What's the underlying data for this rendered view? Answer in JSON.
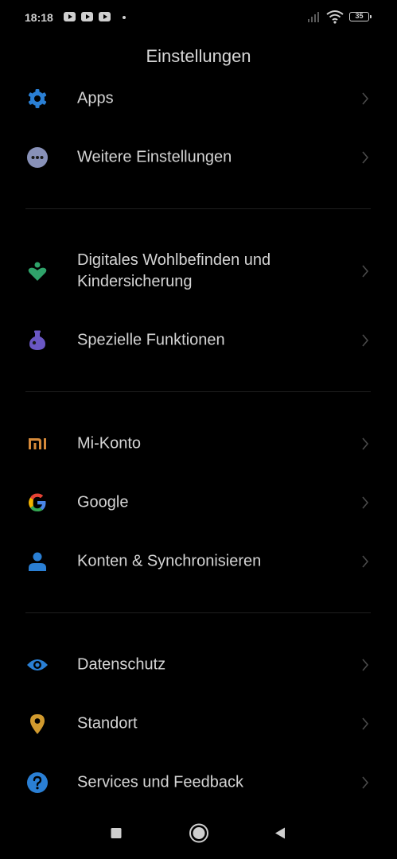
{
  "status_bar": {
    "time": "18:18",
    "notification_icons": [
      "youtube-icon",
      "youtube-icon",
      "youtube-icon"
    ],
    "battery_level": "35"
  },
  "header": {
    "title": "Einstellungen"
  },
  "settings": {
    "apps": {
      "label": "Apps",
      "icon": "gear-icon",
      "color": "#2a7fd4"
    },
    "more": {
      "label": "Weitere Einstellungen",
      "icon": "more-dots-icon",
      "color": "#8891b8"
    },
    "wellbeing": {
      "label": "Digitales Wohlbefinden und Kindersicherung",
      "icon": "heart-person-icon",
      "color": "#2fa36a"
    },
    "special": {
      "label": "Spezielle Funktionen",
      "icon": "flask-icon",
      "color": "#6a57c4"
    },
    "mi_account": {
      "label": "Mi-Konto",
      "icon": "mi-logo-icon",
      "color": "#d68a3a"
    },
    "google": {
      "label": "Google",
      "icon": "google-logo-icon"
    },
    "accounts": {
      "label": "Konten & Synchronisieren",
      "icon": "person-icon",
      "color": "#2a7fd4"
    },
    "privacy": {
      "label": "Datenschutz",
      "icon": "eye-icon",
      "color": "#2a7fd4"
    },
    "location": {
      "label": "Standort",
      "icon": "location-pin-icon",
      "color": "#d19a2e"
    },
    "feedback": {
      "label": "Services und Feedback",
      "icon": "help-icon",
      "color": "#2a7fd4"
    }
  },
  "nav_bar": {
    "buttons": [
      "recents-button",
      "home-button",
      "back-button"
    ]
  }
}
